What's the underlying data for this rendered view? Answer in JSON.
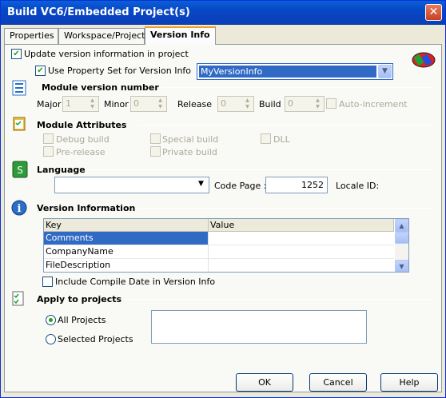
{
  "window": {
    "title": "Build VC6/Embedded Project(s)",
    "close": "✕"
  },
  "tabs": [
    "Properties",
    "Workspace/Project",
    "Version Info"
  ],
  "update_version": {
    "label": "Update version information in project",
    "checked": true
  },
  "use_property_set": {
    "label": "Use Property Set for Version Info",
    "checked": true,
    "value": "MyVersionInfo"
  },
  "module_version": {
    "title": "Module version number",
    "major_label": "Major",
    "major": "1",
    "minor_label": "Minor",
    "minor": "0",
    "release_label": "Release",
    "release": "0",
    "build_label": "Build",
    "build": "0",
    "auto_increment": "Auto-increment"
  },
  "module_attributes": {
    "title": "Module Attributes",
    "debug_build": "Debug build",
    "special_build": "Special build",
    "dll": "DLL",
    "pre_release": "Pre-release",
    "private_build": "Private build"
  },
  "language": {
    "title": "Language",
    "value": "",
    "code_page_label": "Code Page :",
    "code_page": "1252",
    "locale_label": "Locale ID:"
  },
  "version_information": {
    "title": "Version Information",
    "columns": [
      "Key",
      "Value"
    ],
    "rows": [
      {
        "key": "Comments",
        "value": "",
        "selected": true
      },
      {
        "key": "CompanyName",
        "value": ""
      },
      {
        "key": "FileDescription",
        "value": ""
      }
    ]
  },
  "include_compile_date": {
    "label": "Include Compile Date in Version Info",
    "checked": false
  },
  "apply": {
    "title": "Apply to projects",
    "all": "All Projects",
    "selected": "Selected Projects",
    "all_checked": true
  },
  "buttons": {
    "ok": "OK",
    "cancel": "Cancel",
    "help": "Help"
  },
  "check_glyph": "✔",
  "arrows": {
    "up": "▲",
    "down": "▼"
  }
}
